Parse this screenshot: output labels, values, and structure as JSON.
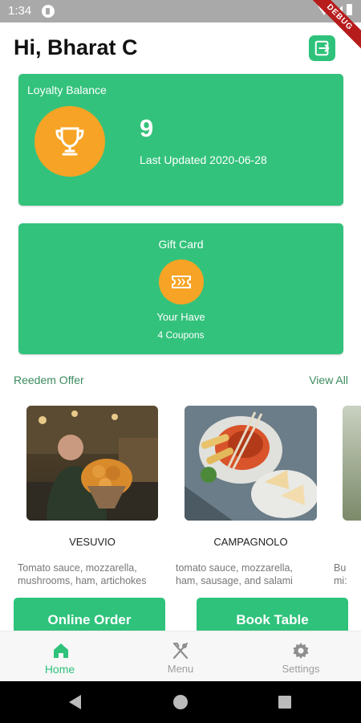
{
  "status_bar": {
    "time": "1:34",
    "debug_label": "DEBUG"
  },
  "header": {
    "greeting": "Hi, Bharat C"
  },
  "loyalty": {
    "title": "Loyalty Balance",
    "points": "9",
    "last_updated": "Last Updated 2020-06-28",
    "icon": "trophy-icon"
  },
  "gift_card": {
    "title": "Gift Card",
    "line1": "Your Have",
    "line2": "4 Coupons",
    "icon": "ticket-icon"
  },
  "offers": {
    "title": "Reedem Offer",
    "view_all": "View All",
    "items": [
      {
        "name": "VESUVIO",
        "description": "Tomato sauce, mozzarella,\nmushrooms, ham, artichokes"
      },
      {
        "name": "CAMPAGNOLO",
        "description": "tomato sauce, mozzarella,\nham, sausage, and salami"
      },
      {
        "name": "",
        "description": "Bu\nmi:"
      }
    ]
  },
  "actions": {
    "online_order": "Online Order",
    "book_table": "Book Table"
  },
  "bottom_nav": {
    "items": [
      {
        "label": "Home",
        "icon": "home-icon",
        "active": true
      },
      {
        "label": "Menu",
        "icon": "fork-knife-icon",
        "active": false
      },
      {
        "label": "Settings",
        "icon": "gear-icon",
        "active": false
      }
    ]
  },
  "colors": {
    "primary_green": "#33c27c",
    "accent_orange": "#f7a325",
    "link_green": "#3b8a5e"
  }
}
